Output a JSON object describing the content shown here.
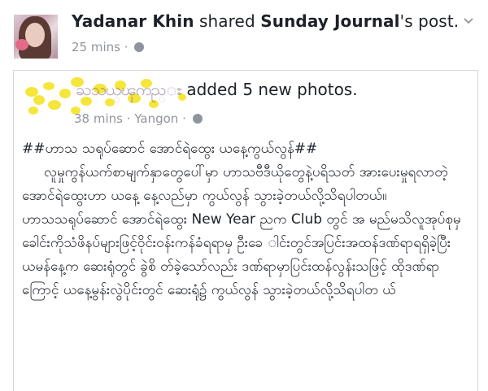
{
  "post": {
    "author": "Yadanar Khin",
    "verb": "shared",
    "source": "Sunday Journal",
    "suffix": "'s post.",
    "time": "25 mins",
    "sep": "·"
  },
  "shared": {
    "name_redacted": "ႀသယ္ၾကည္ႊ",
    "action": "added 5 new photos.",
    "time": "38 mins",
    "sep": "·",
    "location": "Yangon",
    "sep2": "·"
  },
  "content": {
    "para1": "##ဟာသ သရုပ်ဆောင် အောင်ရဲထွေး ယနေ့ကွယ်လွန်##",
    "para2": "     လူမှုကွန်ယက်စာမျက်နှာတွေပေါ်မှာ ဟာသဗီဒီယိုတွေနဲ့ပရိသတ် အားပေးမှုရလာတဲ့ အောင်ရဲထွေးဟာ ယနေ့ နေ့လည်မှာ ကွယ်လွန် သွားခဲ့တယ်လို့သိရပါတယ်။",
    "para3": "ဟာသသရုပ်ဆောင် အောင်ရဲထွေး New Year ညက Club တွင် အ မည်မသိလူအုပ်စုမှ ခေါင်းကိုသံဖိနပ်များဖြင့်ဝိုင်းဝန်းကန်ခံရရာမှ ဦးခေ ါင်းတွင်အပြင်းအထန်ဒဏ်ရာရရှိခဲ့ပြီး ယမန်နေ့က ဆေးရုံတွင် ခွဲစိ တ်ခဲ့သော်လည်း ဒဏ်ရာမှာပြင်းထန်လွန်းသဖြင့် ထိုဒဏ်ရာကြောင့် ယနေ့မွန်းလွဲပိုင်းတွင် ဆေးရုံ၌ ကွယ်လွန် သွားခဲ့တယ်လို့သိရပါတ ယ်"
  }
}
